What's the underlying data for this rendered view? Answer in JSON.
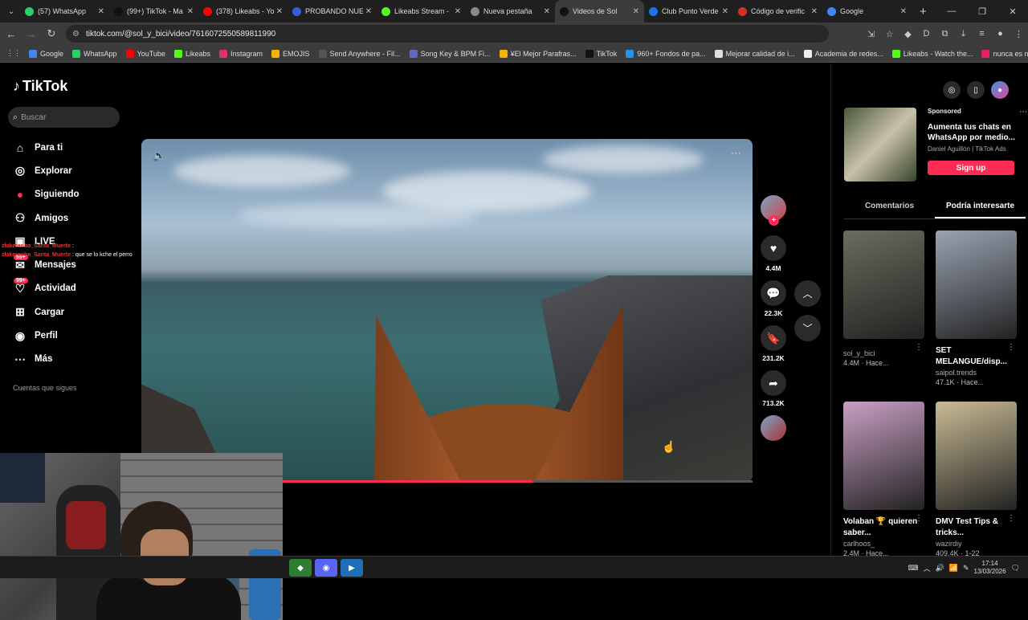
{
  "tabs": [
    {
      "title": "(57) WhatsApp",
      "color": "#25d366",
      "active": false
    },
    {
      "title": "(99+) TikTok - Ma",
      "color": "#111111",
      "active": false
    },
    {
      "title": "(378) Likeabs - Yo",
      "color": "#ff0000",
      "active": false
    },
    {
      "title": "PROBANDO NUE",
      "color": "#3b5bdb",
      "active": false
    },
    {
      "title": "Likeabs Stream -",
      "color": "#53fc18",
      "active": false
    },
    {
      "title": "Nueva pestaña",
      "color": "#888888",
      "active": false
    },
    {
      "title": "Videos de Sol",
      "color": "#111111",
      "active": true
    },
    {
      "title": "Club Punto Verde",
      "color": "#1a73e8",
      "active": false
    },
    {
      "title": "Código de verific",
      "color": "#d93025",
      "active": false
    },
    {
      "title": "Google",
      "color": "#4285f4",
      "active": false
    }
  ],
  "address": {
    "url": "tiktok.com/@sol_y_bici/video/7616072550589811990"
  },
  "bookmarks": [
    {
      "label": "Google",
      "color": "#4285f4"
    },
    {
      "label": "WhatsApp",
      "color": "#25d366"
    },
    {
      "label": "YouTube",
      "color": "#ff0000"
    },
    {
      "label": "Likeabs",
      "color": "#53fc18"
    },
    {
      "label": "Instagram",
      "color": "#e1306c"
    },
    {
      "label": "EMOJIS",
      "color": "#f5b400"
    },
    {
      "label": "Send Anywhere - Fil...",
      "color": "#555555"
    },
    {
      "label": "Song Key & BPM Fi...",
      "color": "#5c6bc0"
    },
    {
      "label": "¥El Mejor Parafras...",
      "color": "#f5b400"
    },
    {
      "label": "TikTok",
      "color": "#111111"
    },
    {
      "label": "960+ Fondos de pa...",
      "color": "#2196f3"
    },
    {
      "label": "Mejorar calidad de i...",
      "color": "#e0e0e0"
    },
    {
      "label": "Academia de redes...",
      "color": "#eeeeee"
    },
    {
      "label": "Likeabs - Watch the...",
      "color": "#53fc18"
    },
    {
      "label": "nunca es nunca :/",
      "color": "#e91e63"
    }
  ],
  "sidebar": {
    "logo": "TikTok",
    "search_placeholder": "Buscar",
    "items": [
      {
        "label": "Para ti",
        "icon": "home-icon"
      },
      {
        "label": "Explorar",
        "icon": "compass-icon"
      },
      {
        "label": "Siguiendo",
        "icon": "following-icon"
      },
      {
        "label": "Amigos",
        "icon": "friends-icon"
      },
      {
        "label": "LIVE",
        "icon": "live-icon"
      },
      {
        "label": "Mensajes",
        "icon": "messages-icon"
      },
      {
        "label": "Actividad",
        "icon": "activity-icon"
      },
      {
        "label": "Cargar",
        "icon": "upload-icon"
      },
      {
        "label": "Perfil",
        "icon": "profile-icon"
      },
      {
        "label": "Más",
        "icon": "more-icon"
      }
    ],
    "messages_badge": "99+",
    "activity_badge": "99+",
    "following_header": "Cuentas que sigues"
  },
  "chat_overlay": [
    {
      "user": "zlakeranba_Santa_Muerte",
      "text": ":"
    },
    {
      "user": "zlakeranba_Santa_Muerte",
      "text": ": que se lo kche el perro"
    }
  ],
  "video": {
    "progress": 0.64
  },
  "actions": [
    {
      "icon": "heart-icon",
      "count": "4.4M"
    },
    {
      "icon": "comment-icon",
      "count": "22.3K"
    },
    {
      "icon": "bookmark-icon",
      "count": "231.2K"
    },
    {
      "icon": "share-icon",
      "count": "713.2K"
    }
  ],
  "ad": {
    "sponsored": "Sponsored",
    "title": "Aumenta tus chats en WhatsApp por medio...",
    "author": "Daniel Aguillón | TikTok Ads",
    "cta": "Sign up"
  },
  "right_tabs": [
    "Comentarios",
    "Podría interesarte"
  ],
  "cards": [
    {
      "caption": "",
      "author": "sol_y_bici",
      "stats": "4.4M · Hace...",
      "thumb": "#6b6b5e"
    },
    {
      "caption": "SET MELANGUE/disp...",
      "author": "saipol.trends",
      "stats": "47.1K · Hace...",
      "thumb": "#9aa3b2"
    },
    {
      "caption": "Volaban 🏆 quieren saber...",
      "author": "carlhoos_",
      "stats": "2.4M · Hace...",
      "thumb": "#c9a0c4"
    },
    {
      "caption": "DMV Test Tips & tricks...",
      "author": "wazirdiy",
      "stats": "409.4K · 1-22",
      "thumb": "#c9bb94"
    }
  ],
  "taskbar": {
    "time": "17:14",
    "date": "13/03/2026"
  },
  "colors": {
    "accent": "#fe2c55",
    "bg": "#000000"
  }
}
